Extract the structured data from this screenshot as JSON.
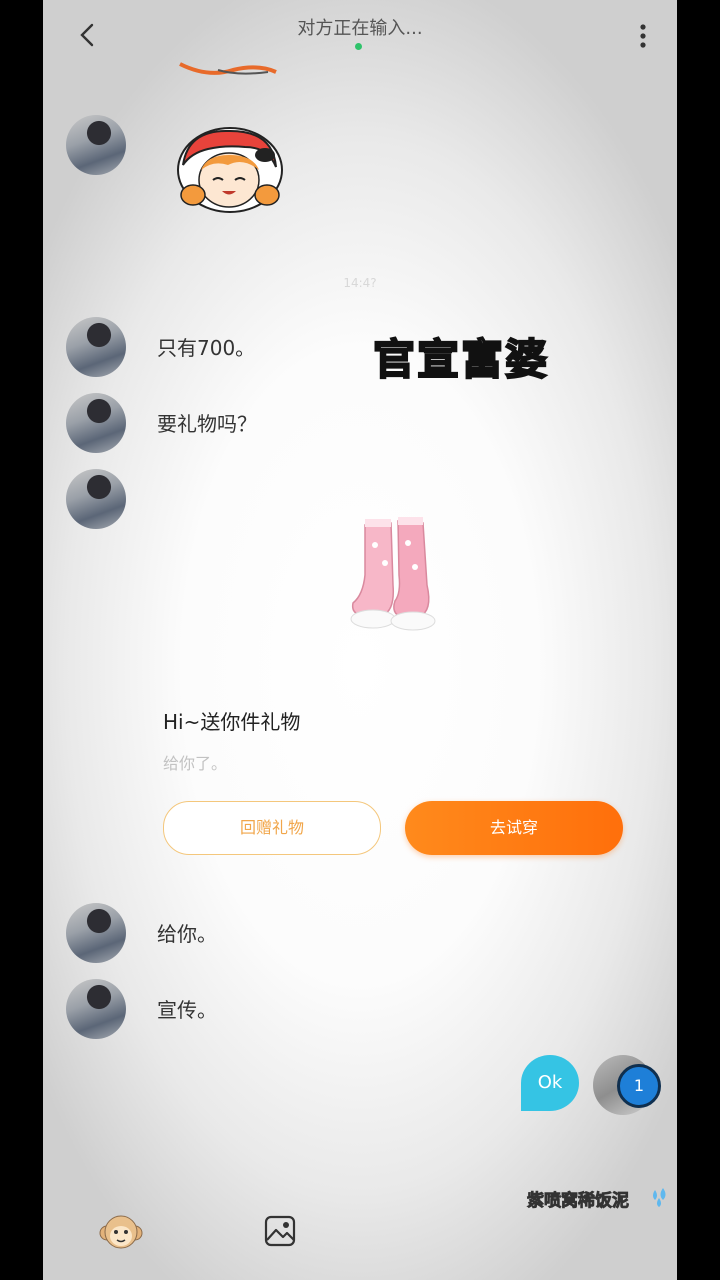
{
  "header": {
    "title": "对方正在输入...",
    "online_color": "#2fc36b"
  },
  "timestamp": "14:4?",
  "messages": [
    {
      "text": "只有700。"
    },
    {
      "text": "要礼物吗？"
    },
    {
      "text": "给你。"
    },
    {
      "text": "宣传。"
    }
  ],
  "overlay_caption": "官宣富婆",
  "gift": {
    "title": "Hi~送你件礼物",
    "subtitle": "给你了。",
    "return_label": "回赠礼物",
    "try_label": "去试穿"
  },
  "self": {
    "bubble_text": "Ok",
    "badge_count": "1"
  },
  "watermark": "紫喷窝稀饭泥",
  "icons": {
    "back": "chevron-left-icon",
    "more": "more-vertical-icon",
    "emoji": "monkey-emoji-icon",
    "image": "image-icon"
  },
  "colors": {
    "accent": "#ff7a12",
    "return_border": "#f4c77c",
    "ok_bubble": "#35c4e4"
  }
}
